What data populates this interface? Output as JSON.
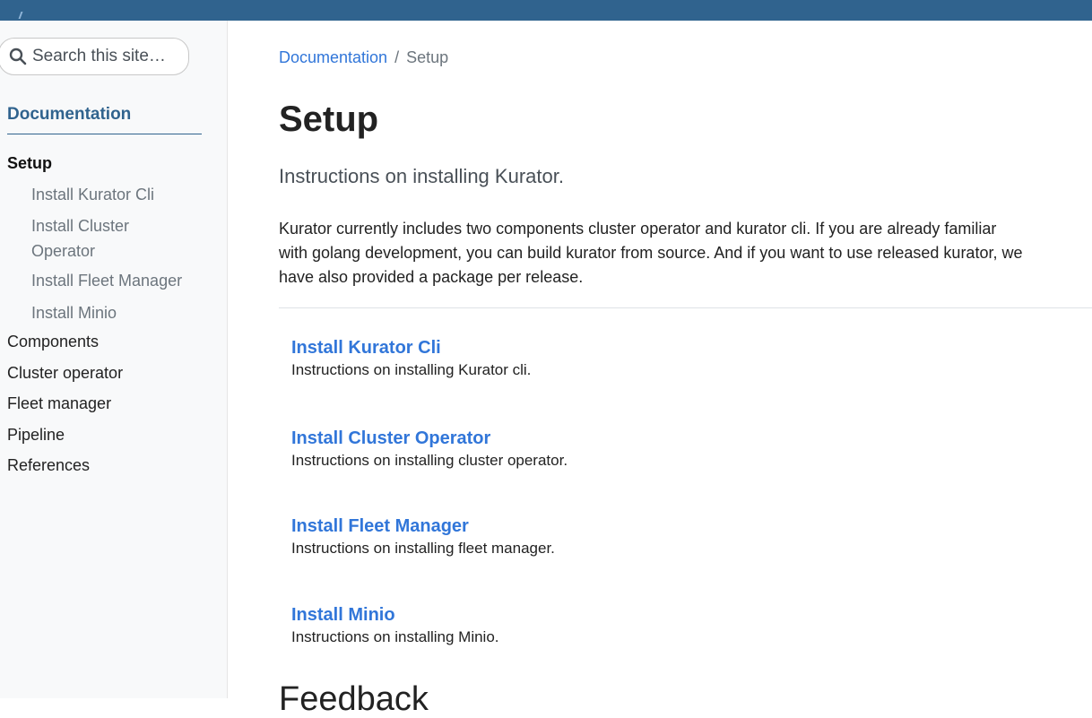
{
  "search": {
    "placeholder": "Search this site…"
  },
  "sidebar": {
    "root_label": "Documentation",
    "items": [
      {
        "label": "Setup"
      },
      {
        "label": "Components"
      },
      {
        "label": "Cluster operator"
      },
      {
        "label": "Fleet manager"
      },
      {
        "label": "Pipeline"
      },
      {
        "label": "References"
      }
    ],
    "setup_children": [
      {
        "label": "Install Kurator Cli"
      },
      {
        "label": "Install Cluster Operator"
      },
      {
        "label": "Install Fleet Manager"
      },
      {
        "label": "Install Minio"
      }
    ]
  },
  "breadcrumb": {
    "parent": "Documentation",
    "separator": "/",
    "current": "Setup"
  },
  "page": {
    "title": "Setup",
    "lead": "Instructions on installing Kurator.",
    "intro": "Kurator currently includes two components cluster operator and kurator cli. If you are already familiar with golang development, you can build kurator from source. And if you want to use released kurator, we have also provided a package per release."
  },
  "entries": [
    {
      "title": "Install Kurator Cli",
      "description": "Instructions on installing Kurator cli."
    },
    {
      "title": "Install Cluster Operator",
      "description": "Instructions on installing cluster operator."
    },
    {
      "title": "Install Fleet Manager",
      "description": "Instructions on installing fleet manager."
    },
    {
      "title": "Install Minio",
      "description": "Instructions on installing Minio."
    }
  ],
  "feedback": {
    "heading": "Feedback"
  },
  "colors": {
    "topbar": "#30638e",
    "link": "#3176d9",
    "sidebar_bg": "#f8f9fa"
  }
}
